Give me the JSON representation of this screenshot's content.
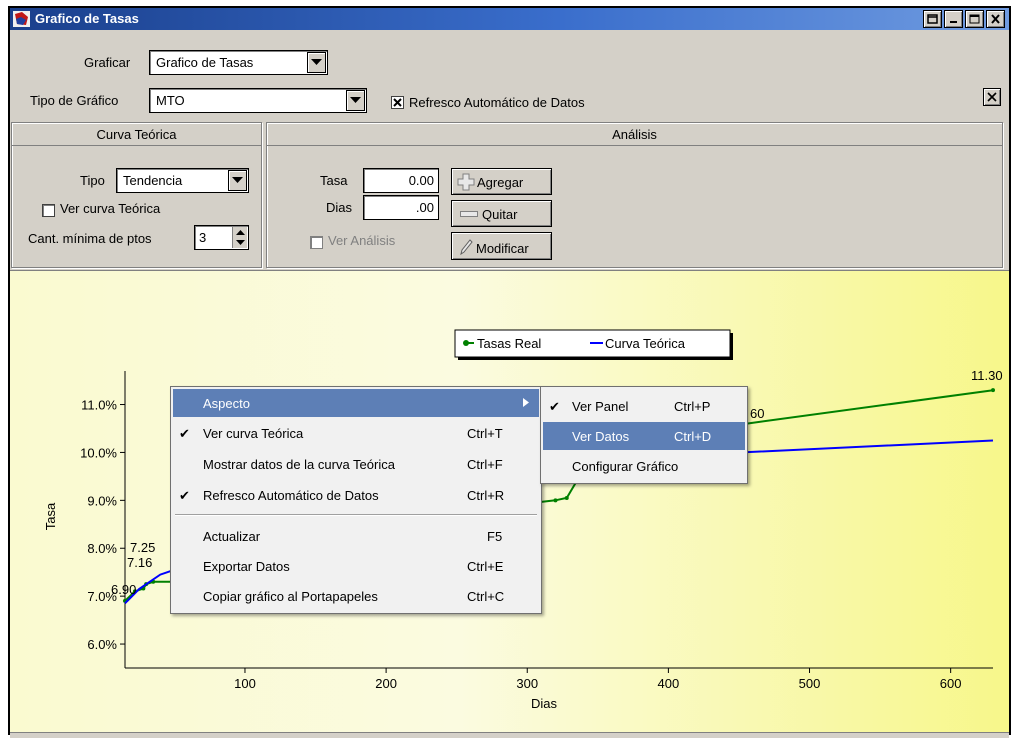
{
  "window": {
    "title": "Grafico de Tasas"
  },
  "controls": {
    "graficar_label": "Graficar",
    "graficar_value": "Grafico de Tasas",
    "tipo_grafico_label": "Tipo de Gráfico",
    "tipo_grafico_value": "MTO",
    "refresco_label": "Refresco Automático de Datos",
    "refresco_checked": true
  },
  "curva_teorica": {
    "header": "Curva Teórica",
    "tipo_label": "Tipo",
    "tipo_value": "Tendencia",
    "ver_curva_label": "Ver curva Teórica",
    "cant_minima_label": "Cant. mínima de ptos",
    "cant_minima_value": "3"
  },
  "analisis": {
    "header": "Análisis",
    "tasa_label": "Tasa",
    "tasa_value": "0.00",
    "dias_label": "Dias",
    "dias_value": ".00",
    "ver_analisis_label": "Ver Análisis",
    "agregar_label": "Agregar",
    "quitar_label": "Quitar",
    "modificar_label": "Modificar"
  },
  "chart_data": {
    "type": "line",
    "xlabel": "Dias",
    "ylabel": "Tasa",
    "xlim": [
      15,
      630
    ],
    "ylim": [
      5.5,
      11.7
    ],
    "x_ticks": [
      "100",
      "200",
      "300",
      "400",
      "500",
      "600"
    ],
    "y_ticks": [
      "6.0%",
      "7.0%",
      "8.0%",
      "9.0%",
      "10.0%",
      "11.0%"
    ],
    "legend": [
      "Tasas Real",
      "Curva Teórica"
    ],
    "series": [
      {
        "name": "Tasas Real",
        "color": "#008000",
        "x": [
          15,
          22,
          28,
          30,
          35,
          50,
          290,
          320,
          328,
          345,
          455,
          630
        ],
        "y": [
          6.9,
          7.1,
          7.16,
          7.25,
          7.3,
          7.3,
          8.9,
          9.0,
          9.05,
          9.9,
          10.6,
          11.3
        ]
      },
      {
        "name": "Curva Teórica",
        "color": "#0000ff",
        "x": [
          15,
          25,
          40,
          60,
          345,
          630
        ],
        "y": [
          6.85,
          7.15,
          7.45,
          7.65,
          9.85,
          10.25
        ]
      }
    ],
    "data_labels": [
      "11.30",
      "60",
      "7.25",
      "7.16",
      "6.90"
    ]
  },
  "context_menu": {
    "items": [
      {
        "label": "Aspecto",
        "shortcut": "",
        "checked": false,
        "submenu": true
      },
      {
        "label": "Ver curva Teórica",
        "shortcut": "Ctrl+T",
        "checked": true
      },
      {
        "label": "Mostrar datos de la curva Teórica",
        "shortcut": "Ctrl+F",
        "checked": false
      },
      {
        "label": "Refresco Automático de Datos",
        "shortcut": "Ctrl+R",
        "checked": true
      },
      {
        "label": "Actualizar",
        "shortcut": "F5",
        "checked": false
      },
      {
        "label": "Exportar Datos",
        "shortcut": "Ctrl+E",
        "checked": false
      },
      {
        "label": "Copiar gráfico al Portapapeles",
        "shortcut": "Ctrl+C",
        "checked": false
      }
    ]
  },
  "submenu": {
    "items": [
      {
        "label": "Ver Panel",
        "shortcut": "Ctrl+P",
        "checked": true
      },
      {
        "label": "Ver Datos",
        "shortcut": "Ctrl+D",
        "checked": false
      },
      {
        "label": "Configurar Gráfico",
        "shortcut": "",
        "checked": false
      }
    ]
  }
}
